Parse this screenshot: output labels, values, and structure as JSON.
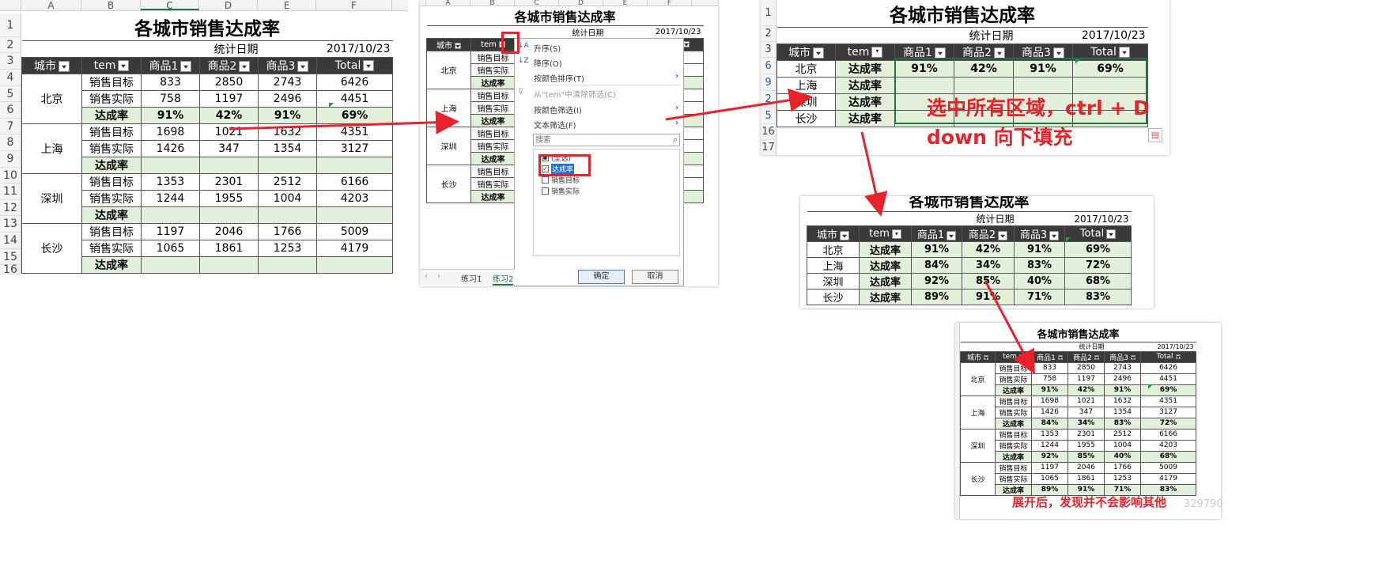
{
  "title": "各城市销售达成率",
  "stat_label": "统计日期",
  "stat_date": "2017/10/23",
  "headers": [
    "城市",
    "tem",
    "商品1",
    "商品2",
    "商品3",
    "Total"
  ],
  "col_letters": [
    "A",
    "B",
    "C",
    "D",
    "E",
    "F"
  ],
  "row_labels": {
    "target": "销售目标",
    "actual": "销售实际",
    "rate": "达成率"
  },
  "cities": [
    {
      "name": "北京",
      "target": [
        "833",
        "2850",
        "2743",
        "6426"
      ],
      "actual": [
        "758",
        "1197",
        "2496",
        "4451"
      ],
      "rate": [
        "91%",
        "42%",
        "91%",
        "69%"
      ]
    },
    {
      "name": "上海",
      "target": [
        "1698",
        "1021",
        "1632",
        "4351"
      ],
      "actual": [
        "1426",
        "347",
        "1354",
        "3127"
      ],
      "rate": [
        "84%",
        "34%",
        "83%",
        "72%"
      ]
    },
    {
      "name": "深圳",
      "target": [
        "1353",
        "2301",
        "2512",
        "6166"
      ],
      "actual": [
        "1244",
        "1955",
        "1004",
        "4203"
      ],
      "rate": [
        "92%",
        "85%",
        "40%",
        "68%"
      ]
    },
    {
      "name": "长沙",
      "target": [
        "1197",
        "2046",
        "1766",
        "5009"
      ],
      "actual": [
        "1065",
        "1861",
        "1253",
        "4179"
      ],
      "rate": [
        "89%",
        "91%",
        "71%",
        "83%"
      ]
    }
  ],
  "row_numbers_p1": [
    "1",
    "2",
    "3",
    "4",
    "5",
    "6",
    "7",
    "8",
    "9",
    "10",
    "11",
    "12",
    "13",
    "14",
    "15",
    "16"
  ],
  "row_numbers_p3": [
    "1",
    "2",
    "3",
    "6",
    "9",
    "2",
    "5",
    "16",
    "17"
  ],
  "filter_menu": {
    "sort_asc": "升序(S)",
    "sort_desc": "降序(O)",
    "sort_color": "按颜色排序(T)",
    "clear_filter": "从\"tem\"中清除筛选(C)",
    "filter_color": "按颜色筛选(I)",
    "text_filter": "文本筛选(F)",
    "search_placeholder": "搜索",
    "options": [
      {
        "label": "(全选)",
        "checked": "partial"
      },
      {
        "label": "达成率",
        "checked": "true"
      },
      {
        "label": "销售目标",
        "checked": "false"
      },
      {
        "label": "销售实际",
        "checked": "false"
      }
    ],
    "ok": "确定",
    "cancel": "取消"
  },
  "sheet_tabs": [
    "练习1",
    "练习2"
  ],
  "annotation_fill_line1": "选中所有区域，ctrl + D",
  "annotation_fill_line2": "down 向下填充",
  "annotation_expand": "展开后，发现并不会影响其他",
  "watermark": "329790",
  "colors": {
    "header_bg": "#3a3a3a",
    "rate_fill": "#e2efda",
    "selection_fill": "#aab5a3",
    "annotation_red": "#e8222a",
    "excel_green": "#217346"
  }
}
